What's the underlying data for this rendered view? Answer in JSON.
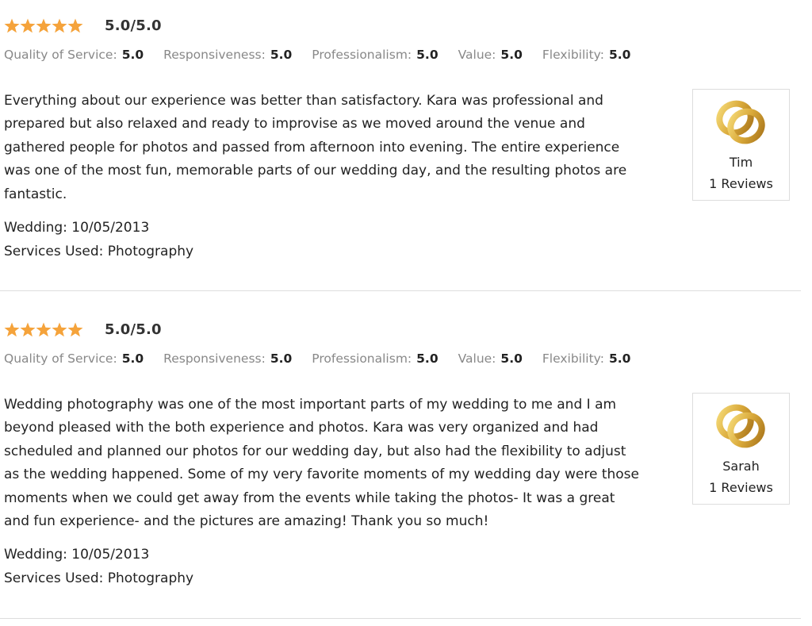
{
  "colors": {
    "star": "#f5a33b",
    "muted_label": "#888888",
    "text": "#222222",
    "divider": "#dddddd",
    "ring_gold": "#d9a93a"
  },
  "icons": {
    "star": "star-icon",
    "reviewer_avatar": "wedding-rings-icon"
  },
  "reviews": [
    {
      "stars": 5,
      "overall": "5.0/5.0",
      "sub_ratings": [
        {
          "label": "Quality of Service:",
          "value": "5.0"
        },
        {
          "label": "Responsiveness:",
          "value": "5.0"
        },
        {
          "label": "Professionalism:",
          "value": "5.0"
        },
        {
          "label": "Value:",
          "value": "5.0"
        },
        {
          "label": "Flexibility:",
          "value": "5.0"
        }
      ],
      "lines": [
        "Everything about our experience was better than satisfactory. Kara was professional and",
        "prepared but also relaxed and ready to improvise as we moved around the venue and",
        "gathered people for photos and passed from afternoon into evening. The entire experience",
        "was one of the most fun, memorable parts of our wedding day, and the resulting photos are",
        "fantastic."
      ],
      "wedding": "Wedding: 10/05/2013",
      "services": "Services Used: Photography",
      "reviewer": {
        "name": "Tim",
        "count": "1 Reviews"
      }
    },
    {
      "stars": 5,
      "overall": "5.0/5.0",
      "sub_ratings": [
        {
          "label": "Quality of Service:",
          "value": "5.0"
        },
        {
          "label": "Responsiveness:",
          "value": "5.0"
        },
        {
          "label": "Professionalism:",
          "value": "5.0"
        },
        {
          "label": "Value:",
          "value": "5.0"
        },
        {
          "label": "Flexibility:",
          "value": "5.0"
        }
      ],
      "lines": [
        "Wedding photography was one of the most important parts of my wedding to me and I am",
        "beyond pleased with the both experience and photos. Kara was very organized and had",
        "scheduled and planned our photos for our wedding day, but also had the flexibility to adjust",
        "as the wedding happened. Some of my very favorite moments of my wedding day were those",
        "moments when we could get away from the events while taking the photos- It was a great",
        "and fun experience- and the pictures are amazing! Thank you so much!"
      ],
      "wedding": "Wedding: 10/05/2013",
      "services": "Services Used: Photography",
      "reviewer": {
        "name": "Sarah",
        "count": "1 Reviews"
      }
    }
  ]
}
